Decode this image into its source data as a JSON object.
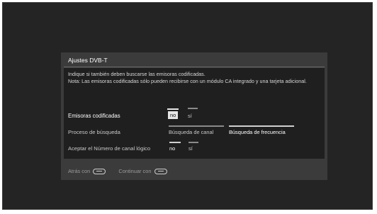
{
  "dialog": {
    "title": "Ajustes DVB-T",
    "info_line1": "Indique si también deben buscarse las emisoras codificadas.",
    "info_line2": "Nota: Las emisoras codificadas sólo pueden recibirse con un módulo CA integrado y una tarjeta adicional."
  },
  "rows": {
    "encoded": {
      "label": "Emisoras codificadas",
      "options": [
        "no",
        "sí"
      ]
    },
    "search": {
      "label": "Proceso de búsqueda",
      "options": [
        "Búsqueda de canal",
        "Búsqueda de frecuencia"
      ]
    },
    "lcn": {
      "label": "Aceptar el Número de canal lógico",
      "options": [
        "no",
        "sí"
      ]
    }
  },
  "footer": {
    "back": "Atrás con",
    "next": "Continuar con"
  },
  "icons": {
    "back_key": "remote-key-back-icon",
    "next_key": "remote-key-forward-icon"
  }
}
